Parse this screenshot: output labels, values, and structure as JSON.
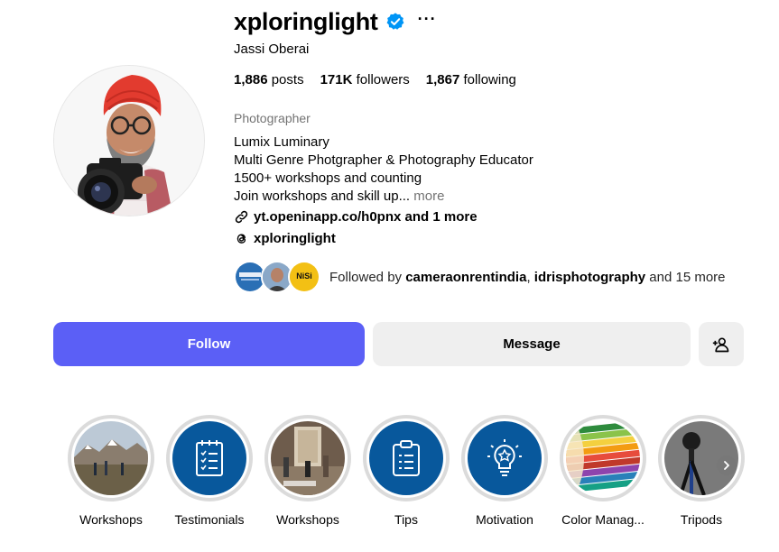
{
  "profile": {
    "username": "xploringlight",
    "full_name": "Jassi Oberai",
    "more_label": "···",
    "stats": {
      "posts_count": "1,886",
      "posts_label": "posts",
      "followers_count": "171K",
      "followers_label": "followers",
      "following_count": "1,867",
      "following_label": "following"
    },
    "category": "Photographer",
    "bio_lines": [
      "Lumix Luminary",
      "Multi Genre Photgrapher & Photography Educator",
      "1500+ workshops and counting",
      "Join workshops and skill up..."
    ],
    "bio_more": "more",
    "link_text": "yt.openinapp.co/h0pnx and 1 more",
    "threads_handle": "xploringlight",
    "followed_by": {
      "prefix": "Followed by ",
      "user1": "cameraonrentindia",
      "separator": ", ",
      "user2": "idrisphotography",
      "suffix": " and 15 more"
    }
  },
  "actions": {
    "follow_label": "Follow",
    "message_label": "Message"
  },
  "highlights": [
    {
      "label": "Workshops",
      "icon": "landscape-photo"
    },
    {
      "label": "Testimonials",
      "icon": "checklist-notepad-icon"
    },
    {
      "label": "Workshops",
      "icon": "workshop-photo"
    },
    {
      "label": "Tips",
      "icon": "clipboard-icon"
    },
    {
      "label": "Motivation",
      "icon": "lightbulb-icon"
    },
    {
      "label": "Color Manag...",
      "icon": "color-pencils-photo"
    },
    {
      "label": "Tripods",
      "icon": "tripod-photo"
    }
  ],
  "colors": {
    "follow_button": "#5b5ff6",
    "secondary_button": "#efefef",
    "verified_badge": "#0095f6",
    "highlight_blue": "#08589c",
    "muted_text": "#737373"
  }
}
